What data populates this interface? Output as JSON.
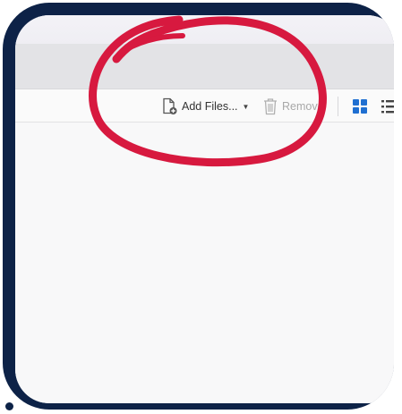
{
  "toolbar": {
    "add_files_label": "Add Files...",
    "add_files_icon": "add-file-icon",
    "remove_label": "Remove",
    "remove_icon": "trash-icon",
    "grid_view_icon": "grid-view-icon",
    "list_view_icon": "list-view-icon"
  },
  "colors": {
    "frame": "#0d2247",
    "annotation": "#d7193f",
    "grid_icon": "#1f6fd1"
  }
}
